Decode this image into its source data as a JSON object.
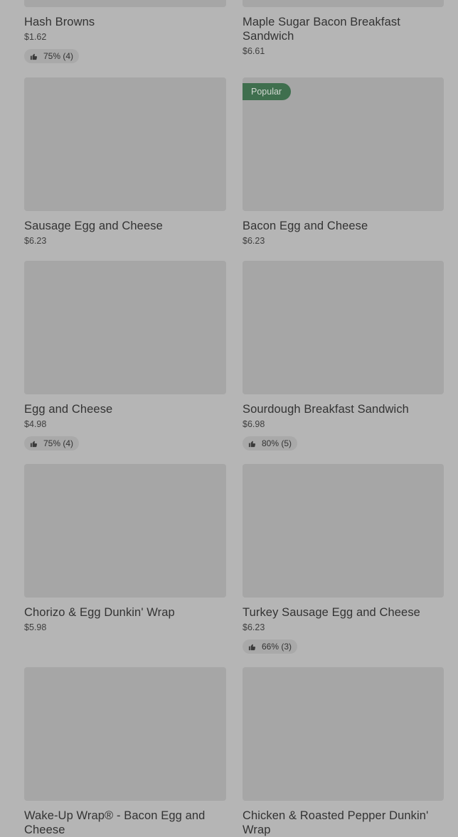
{
  "items": [
    {
      "name": "Hash Browns",
      "price": "$1.62",
      "rating": "75% (4)"
    },
    {
      "name": "Maple Sugar Bacon Breakfast Sandwich",
      "price": "$6.61"
    },
    {
      "name": "Sausage Egg and Cheese",
      "price": "$6.23"
    },
    {
      "name": "Bacon Egg and Cheese",
      "price": "$6.23",
      "badge": "Popular"
    },
    {
      "name": "Egg and Cheese",
      "price": "$4.98",
      "rating": "75% (4)"
    },
    {
      "name": "Sourdough Breakfast Sandwich",
      "price": "$6.98",
      "rating": "80% (5)"
    },
    {
      "name": "Chorizo & Egg Dunkin' Wrap",
      "price": "$5.98"
    },
    {
      "name": "Turkey Sausage Egg and Cheese",
      "price": "$6.23",
      "rating": "66% (3)"
    },
    {
      "name": "Wake-Up Wrap® - Bacon Egg and Cheese"
    },
    {
      "name": "Chicken & Roasted Pepper Dunkin' Wrap"
    }
  ],
  "colors": {
    "background": "#b5b5b5",
    "image_placeholder": "#a6a6a6",
    "popular_badge": "#3f6f4e",
    "rating_pill": "#a9a9a9"
  },
  "icons": {
    "rating": "thumbs-up-icon"
  }
}
